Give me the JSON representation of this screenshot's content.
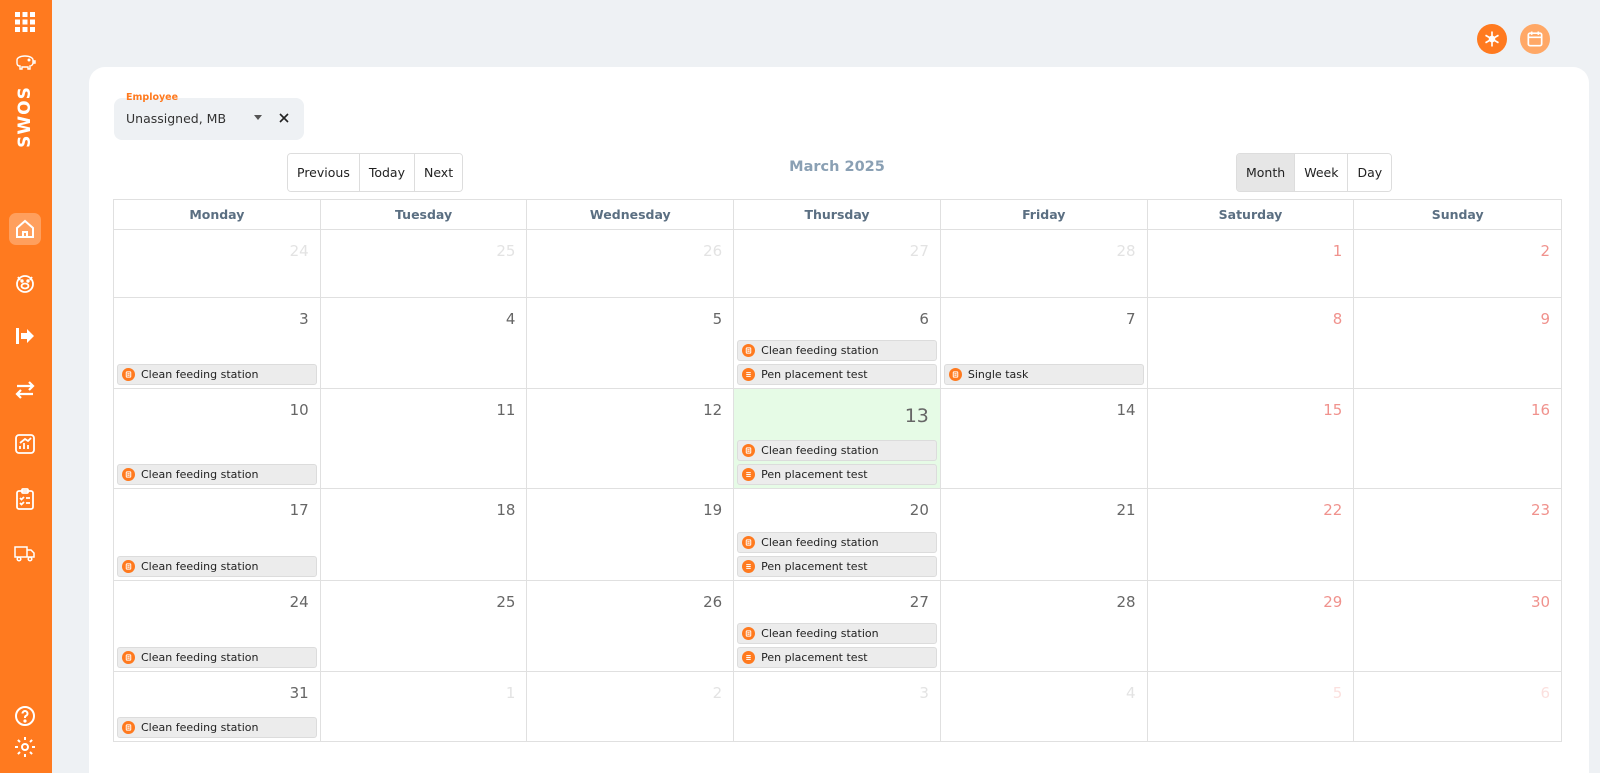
{
  "app": {
    "brand": "SWOS"
  },
  "employee_filter": {
    "label": "Employee",
    "value": "Unassigned, MB"
  },
  "nav": {
    "previous": "Previous",
    "today": "Today",
    "next": "Next"
  },
  "calendar_title": "March 2025",
  "views": [
    {
      "label": "Month",
      "active": true
    },
    {
      "label": "Week",
      "active": false
    },
    {
      "label": "Day",
      "active": false
    }
  ],
  "weekdays": [
    "Monday",
    "Tuesday",
    "Wednesday",
    "Thursday",
    "Friday",
    "Saturday",
    "Sunday"
  ],
  "weeks": [
    {
      "days": [
        {
          "num": "24",
          "other": true
        },
        {
          "num": "25",
          "other": true
        },
        {
          "num": "26",
          "other": true
        },
        {
          "num": "27",
          "other": true
        },
        {
          "num": "28",
          "other": true
        },
        {
          "num": "1"
        },
        {
          "num": "2"
        }
      ]
    },
    {
      "days": [
        {
          "num": "3",
          "events": [
            {
              "title": "Clean feeding station",
              "icon": "task-icon"
            }
          ]
        },
        {
          "num": "4"
        },
        {
          "num": "5"
        },
        {
          "num": "6",
          "events": [
            {
              "title": "Clean feeding station",
              "icon": "task-icon"
            },
            {
              "title": "Pen placement test",
              "icon": "list-icon"
            }
          ]
        },
        {
          "num": "7",
          "events": [
            {
              "title": "Single task",
              "icon": "task-icon"
            }
          ]
        },
        {
          "num": "8"
        },
        {
          "num": "9"
        }
      ]
    },
    {
      "days": [
        {
          "num": "10",
          "events": [
            {
              "title": "Clean feeding station",
              "icon": "task-icon"
            }
          ]
        },
        {
          "num": "11"
        },
        {
          "num": "12"
        },
        {
          "num": "13",
          "today": true,
          "events": [
            {
              "title": "Clean feeding station",
              "icon": "task-icon"
            },
            {
              "title": "Pen placement test",
              "icon": "list-icon"
            }
          ]
        },
        {
          "num": "14"
        },
        {
          "num": "15"
        },
        {
          "num": "16"
        }
      ]
    },
    {
      "days": [
        {
          "num": "17",
          "events": [
            {
              "title": "Clean feeding station",
              "icon": "task-icon"
            }
          ]
        },
        {
          "num": "18"
        },
        {
          "num": "19"
        },
        {
          "num": "20",
          "events": [
            {
              "title": "Clean feeding station",
              "icon": "task-icon"
            },
            {
              "title": "Pen placement test",
              "icon": "list-icon"
            }
          ]
        },
        {
          "num": "21"
        },
        {
          "num": "22"
        },
        {
          "num": "23"
        }
      ]
    },
    {
      "days": [
        {
          "num": "24",
          "events": [
            {
              "title": "Clean feeding station",
              "icon": "task-icon"
            }
          ]
        },
        {
          "num": "25"
        },
        {
          "num": "26"
        },
        {
          "num": "27",
          "events": [
            {
              "title": "Clean feeding station",
              "icon": "task-icon"
            },
            {
              "title": "Pen placement test",
              "icon": "list-icon"
            }
          ]
        },
        {
          "num": "28"
        },
        {
          "num": "29"
        },
        {
          "num": "30"
        }
      ]
    },
    {
      "days": [
        {
          "num": "31",
          "events": [
            {
              "title": "Clean feeding station",
              "icon": "task-icon"
            }
          ]
        },
        {
          "num": "1",
          "other": true
        },
        {
          "num": "2",
          "other": true
        },
        {
          "num": "3",
          "other": true
        },
        {
          "num": "4",
          "other": true
        },
        {
          "num": "5",
          "other": true
        },
        {
          "num": "6",
          "other": true
        }
      ]
    }
  ],
  "colors": {
    "accent": "#ff7a1f",
    "today_bg": "#e6fbe6",
    "weekend_text": "#f0928d",
    "title_text": "#8aa0b4"
  }
}
